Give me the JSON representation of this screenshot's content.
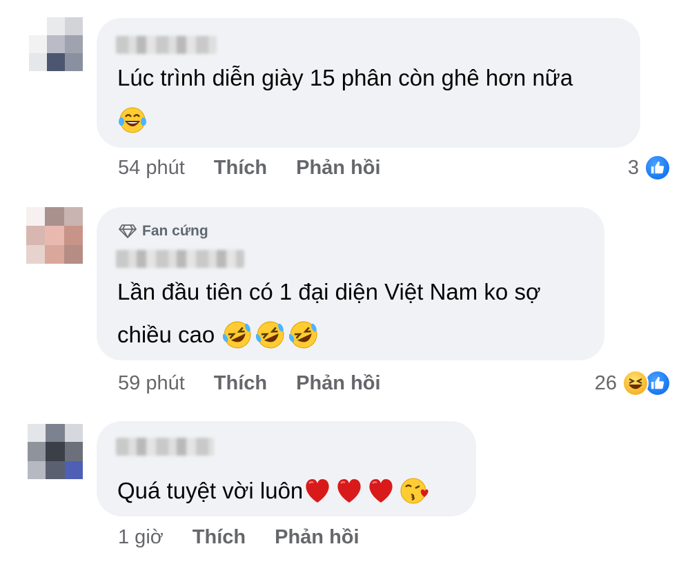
{
  "comments": [
    {
      "text_lines": [
        "Lúc trình diễn giày 15 phân còn ghê hơn nữa"
      ],
      "emojis_line2": [
        "laughing-tears"
      ],
      "time": "54 phút",
      "like_label": "Thích",
      "reply_label": "Phản hồi",
      "reaction_count": "3",
      "reactions": [
        "like"
      ]
    },
    {
      "badge": "Fan cứng",
      "text_lines": [
        "Lần đầu tiên có 1 đại diện Việt Nam ko sợ",
        "chiều cao"
      ],
      "emojis_inline": [
        "rofl",
        "rofl",
        "rofl"
      ],
      "time": "59 phút",
      "like_label": "Thích",
      "reply_label": "Phản hồi",
      "reaction_count": "26",
      "reactions": [
        "haha",
        "like"
      ]
    },
    {
      "text_lines": [
        "Quá tuyệt vời luôn"
      ],
      "emojis_inline": [
        "red-heart",
        "red-heart",
        "red-heart",
        "kissing-heart"
      ],
      "time": "1 giờ",
      "like_label": "Thích",
      "reply_label": "Phản hồi"
    }
  ],
  "colors": {
    "bubble": "#f0f2f5",
    "meta_text": "#65676b",
    "like_blue": "#1877f2",
    "heart_red": "#d91a1a"
  }
}
